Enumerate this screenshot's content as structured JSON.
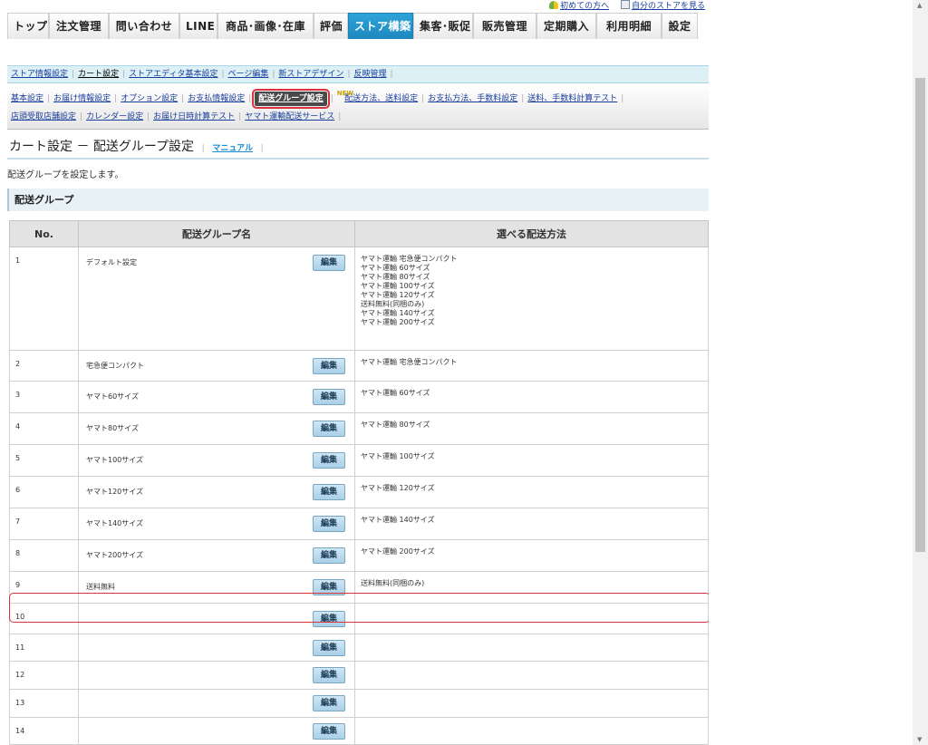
{
  "utility": {
    "first_time": "初めての方へ",
    "view_store": "自分のストアを見る"
  },
  "mainnav": {
    "tabs": [
      "トップ",
      "注文管理",
      "問い合わせ",
      "LINE",
      "商品･画像･在庫",
      "評価",
      "ストア構築",
      "集客･販促",
      "販売管理",
      "定期購入",
      "利用明細",
      "設定"
    ],
    "active": "ストア構築"
  },
  "subnav1": [
    "ストア情報設定",
    "カート設定",
    "ストアエディタ基本設定",
    "ページ編集",
    "新ストアデザイン",
    "反映管理"
  ],
  "subnav2": {
    "line1": [
      "基本設定",
      "お届け情報設定",
      "オプション設定",
      "お支払情報設定",
      "配送グループ設定",
      "配送方法、送料設定",
      "お支払方法、手数料設定",
      "送料、手数料計算テスト"
    ],
    "line2": [
      "店頭受取店舗設定",
      "カレンダー設定",
      "お届け日時計算テスト",
      "ヤマト運輸配送サービス"
    ],
    "new_badge": "NEW"
  },
  "page": {
    "title": "カート設定 － 配送グループ設定",
    "manual": "マニュアル",
    "description": "配送グループを設定します。",
    "section": "配送グループ"
  },
  "table": {
    "headers": [
      "No.",
      "配送グループ名",
      "選べる配送方法"
    ],
    "edit_label": "編集",
    "rows": [
      {
        "no": "1",
        "name": "デフォルト設定",
        "methods": [
          "ヤマト運輸 宅急便コンパクト",
          "ヤマト運輸 60サイズ",
          "ヤマト運輸 80サイズ",
          "ヤマト運輸 100サイズ",
          "ヤマト運輸 120サイズ",
          "送料無料(同梱のみ)",
          "ヤマト運輸 140サイズ",
          "ヤマト運輸 200サイズ"
        ]
      },
      {
        "no": "2",
        "name": "宅急便コンパクト",
        "methods": [
          "ヤマト運輸 宅急便コンパクト"
        ]
      },
      {
        "no": "3",
        "name": "ヤマト60サイズ",
        "methods": [
          "ヤマト運輸 60サイズ"
        ]
      },
      {
        "no": "4",
        "name": "ヤマト80サイズ",
        "methods": [
          "ヤマト運輸 80サイズ"
        ]
      },
      {
        "no": "5",
        "name": "ヤマト100サイズ",
        "methods": [
          "ヤマト運輸 100サイズ"
        ]
      },
      {
        "no": "6",
        "name": "ヤマト120サイズ",
        "methods": [
          "ヤマト運輸 120サイズ"
        ]
      },
      {
        "no": "7",
        "name": "ヤマト140サイズ",
        "methods": [
          "ヤマト運輸 140サイズ"
        ]
      },
      {
        "no": "8",
        "name": "ヤマト200サイズ",
        "methods": [
          "ヤマト運輸 200サイズ"
        ]
      },
      {
        "no": "9",
        "name": "送料無料",
        "methods": [
          "送料無料(同梱のみ)"
        ]
      },
      {
        "no": "10",
        "name": "",
        "methods": []
      },
      {
        "no": "11",
        "name": "",
        "methods": []
      },
      {
        "no": "12",
        "name": "",
        "methods": []
      },
      {
        "no": "13",
        "name": "",
        "methods": []
      },
      {
        "no": "14",
        "name": "",
        "methods": []
      }
    ]
  },
  "colors": {
    "active_tab": "#1c87bf",
    "highlight": "#d9343d",
    "subnav_bg": "#dcf0f6"
  }
}
